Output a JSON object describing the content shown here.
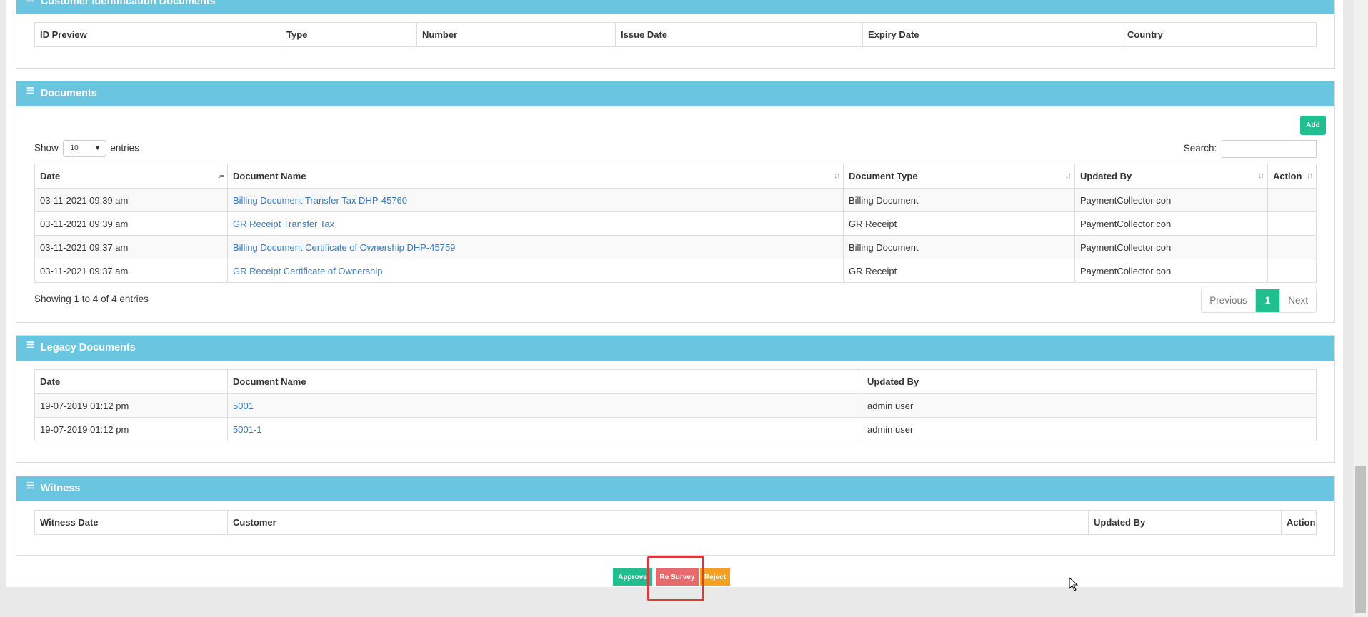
{
  "id_docs": {
    "title": "Customer Identification Documents",
    "headers": [
      "ID Preview",
      "Type",
      "Number",
      "Issue Date",
      "Expiry Date",
      "Country"
    ]
  },
  "documents": {
    "title": "Documents",
    "add_label": "Add",
    "show_label": "Show",
    "entries_label": "entries",
    "entries_value": "10",
    "search_label": "Search:",
    "search_value": "",
    "headers": [
      "Date",
      "Document Name",
      "Document Type",
      "Updated By",
      "Action"
    ],
    "rows": [
      {
        "date": "03-11-2021 09:39 am",
        "name": "Billing Document Transfer Tax DHP-45760",
        "type": "Billing Document",
        "by": "PaymentCollector coh",
        "action": ""
      },
      {
        "date": "03-11-2021 09:39 am",
        "name": "GR Receipt Transfer Tax",
        "type": "GR Receipt",
        "by": "PaymentCollector coh",
        "action": ""
      },
      {
        "date": "03-11-2021 09:37 am",
        "name": "Billing Document Certificate of Ownership DHP-45759",
        "type": "Billing Document",
        "by": "PaymentCollector coh",
        "action": ""
      },
      {
        "date": "03-11-2021 09:37 am",
        "name": "GR Receipt Certificate of Ownership",
        "type": "GR Receipt",
        "by": "PaymentCollector coh",
        "action": ""
      }
    ],
    "info": "Showing 1 to 4 of 4 entries",
    "pager": {
      "previous": "Previous",
      "current": "1",
      "next": "Next"
    }
  },
  "legacy": {
    "title": "Legacy Documents",
    "headers": [
      "Date",
      "Document Name",
      "Updated By"
    ],
    "rows": [
      {
        "date": "19-07-2019 01:12 pm",
        "name": "5001",
        "by": "admin user"
      },
      {
        "date": "19-07-2019 01:12 pm",
        "name": "5001-1",
        "by": "admin user"
      }
    ]
  },
  "witness": {
    "title": "Witness",
    "headers": [
      "Witness Date",
      "Customer",
      "Updated By",
      "Action"
    ]
  },
  "actions": {
    "approve": "Approve",
    "resurvey": "Re Survey",
    "reject": "Reject"
  },
  "colors": {
    "panel_header": "#6ac5e0",
    "approve": "#1fbf8f",
    "resurvey": "#e8696b",
    "reject": "#f5a021",
    "link": "#3a79b6",
    "highlight": "#e0363c"
  },
  "icons": {
    "panel": "list-icon",
    "sort": "sort-icon",
    "cursor": "mouse-pointer-icon"
  }
}
